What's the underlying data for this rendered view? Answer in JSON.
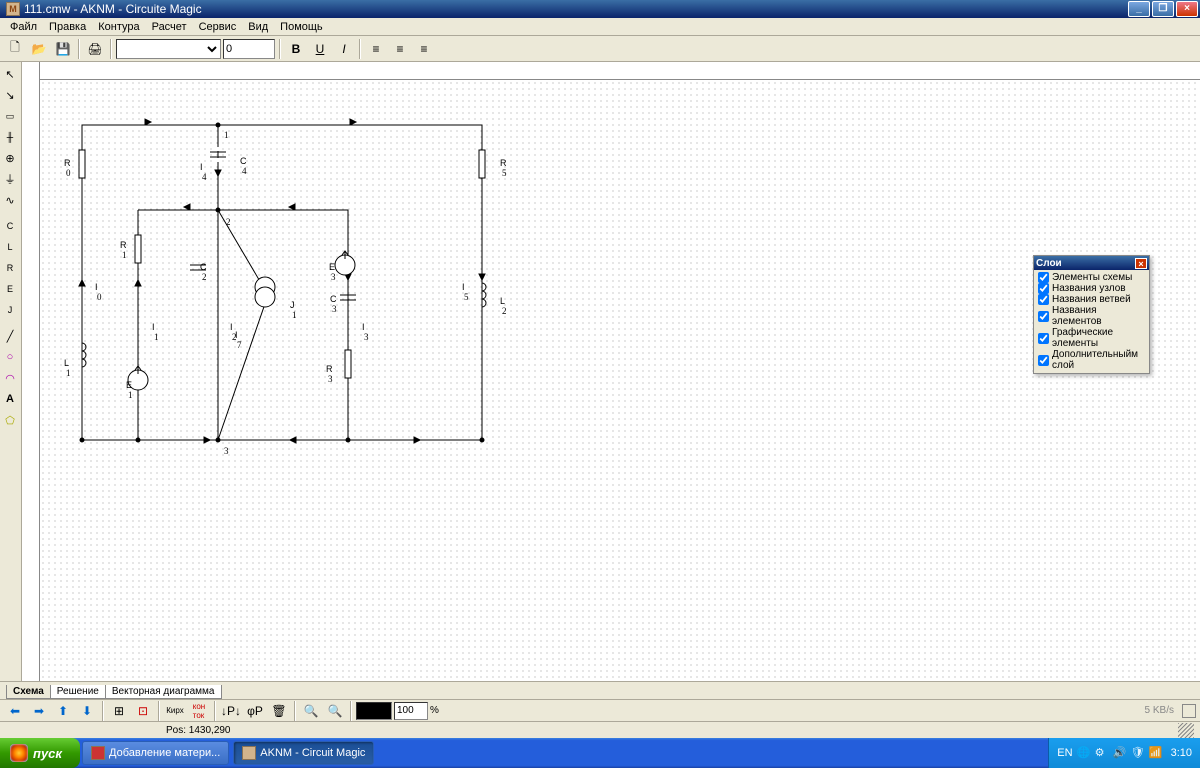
{
  "title": "111.cmw - AKNM - Circuite Magic",
  "menu": [
    "Файл",
    "Правка",
    "Контура",
    "Расчет",
    "Сервис",
    "Вид",
    "Помощь"
  ],
  "format_toolbar": {
    "font_size": "0"
  },
  "layers": {
    "title": "Слои",
    "items": [
      {
        "label": "Элементы схемы",
        "checked": true
      },
      {
        "label": "Названия узлов",
        "checked": true
      },
      {
        "label": "Названия ветвей",
        "checked": true
      },
      {
        "label": "Названия элементов",
        "checked": true
      },
      {
        "label": "Графические элементы",
        "checked": true
      },
      {
        "label": "Дополнительныйм слой",
        "checked": true
      }
    ]
  },
  "bottom_tabs": [
    "Схема",
    "Решение",
    "Векторная диаграмма"
  ],
  "zoom": "100",
  "status": {
    "pos": "Pos: 1430,290",
    "rate": "5 KB/s"
  },
  "taskbar": {
    "start": "пуск",
    "buttons": [
      {
        "label": "Добавление матери...",
        "active": false
      },
      {
        "label": "AKNM - Circuit Magic",
        "active": true
      }
    ],
    "lang": "EN",
    "time": "3:10"
  },
  "schematic_labels": {
    "node1": "1",
    "node2": "2",
    "node3": "3",
    "R0": "R",
    "R0s": "0",
    "R1": "R",
    "R1s": "1",
    "R3": "R",
    "R3s": "3",
    "R5": "R",
    "R5s": "5",
    "C2": "C",
    "C2s": "2",
    "C3": "C",
    "C3s": "3",
    "C4": "C",
    "C4s": "4",
    "L1": "L",
    "L1s": "1",
    "L2": "L",
    "L2s": "2",
    "E1": "E",
    "E1s": "1",
    "E3": "E",
    "E3s": "3",
    "J1": "J",
    "J1s": "1",
    "I0": "I",
    "I0s": "0",
    "I1": "I",
    "I1s": "1",
    "I2": "I",
    "I2s": "2",
    "I3": "I",
    "I3s": "3",
    "I4": "I",
    "I4s": "4",
    "I5": "I",
    "I5s": "5",
    "I7": "I",
    "I7s": "7"
  }
}
